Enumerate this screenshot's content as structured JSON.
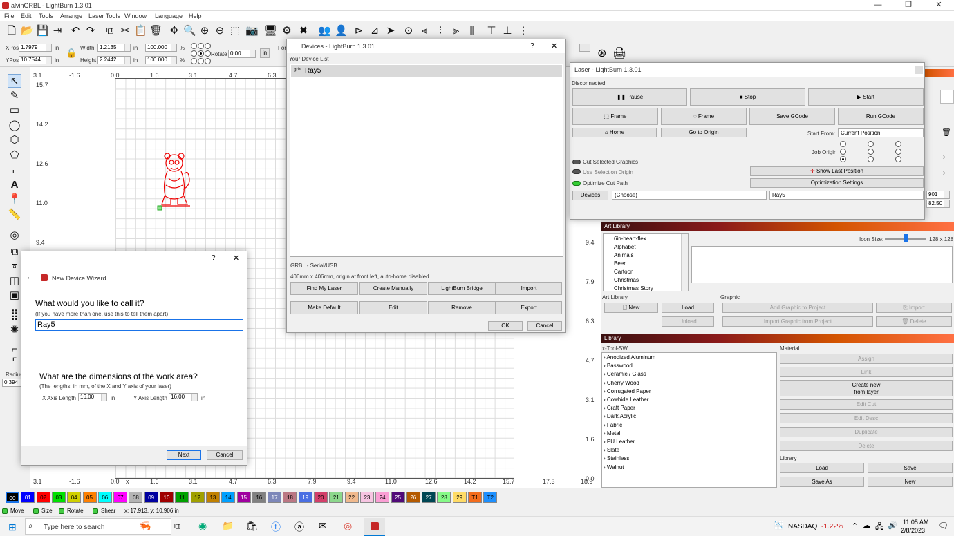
{
  "window": {
    "title": "alvinGRBL - LightBurn 1.3.01",
    "min": "—",
    "max": "❐",
    "close": "✕"
  },
  "menu": [
    "File",
    "Edit",
    "Tools",
    "Arrange",
    "Laser Tools",
    "Window",
    "Language",
    "Help"
  ],
  "numbar": {
    "xpos_label": "XPos",
    "xpos": "1.7979",
    "ypos_label": "YPos",
    "ypos": "10.7544",
    "unit": "in",
    "width_label": "Width",
    "width": "1.2135",
    "height_label": "Height",
    "height": "2.2442",
    "pct1": "100.000",
    "pct2": "100.000",
    "pct_sign": "%",
    "rotate_label": "Rotate",
    "rotate": "0.00",
    "rot_unit": "in",
    "font_label": "For"
  },
  "canvas": {
    "xticks": [
      "3.1",
      "-1.6",
      "0.0",
      "1.6",
      "3.1",
      "4.7",
      "6.3"
    ],
    "yticks": [
      "15.7",
      "14.2",
      "12.6",
      "11.0",
      "9.4"
    ],
    "bottom_ticks": [
      "3.1",
      "-1.6",
      "0.0",
      "x",
      "1.6",
      "3.1",
      "4.7",
      "6.3",
      "7.9",
      "9.4",
      "11.0",
      "12.6",
      "14.2",
      "15.7",
      "17.3",
      "18.9"
    ],
    "right_yticks": [
      "9.4",
      "7.9",
      "6.3",
      "4.7",
      "3.1",
      "1.6",
      "0.0"
    ],
    "radius_label": "Radius",
    "radius": "0.394"
  },
  "palette": [
    "00",
    "01",
    "02",
    "03",
    "04",
    "05",
    "06",
    "07",
    "08",
    "09",
    "10",
    "11",
    "12",
    "13",
    "14",
    "15",
    "16",
    "17",
    "18",
    "19",
    "20",
    "21",
    "22",
    "23",
    "24",
    "25",
    "26",
    "27",
    "28",
    "29",
    "T1",
    "T2"
  ],
  "palette_colors": [
    "#000000",
    "#0000ff",
    "#ff0000",
    "#00e000",
    "#d0d000",
    "#ff8000",
    "#00ffff",
    "#ff00ff",
    "#b4b4b4",
    "#0000a0",
    "#a00000",
    "#00a000",
    "#a0a000",
    "#c08000",
    "#00a0ff",
    "#a000a0",
    "#808080",
    "#7d87b9",
    "#bb7784",
    "#4a6fe3",
    "#d33f6a",
    "#8cd78c",
    "#f0b98d",
    "#f6c4e1",
    "#fa9ed4",
    "#500a78",
    "#b45a00",
    "#004754",
    "#86fa88",
    "#ffdb66",
    "#f36c1d",
    "#1e90ff"
  ],
  "status": {
    "move": "Move",
    "size": "Size",
    "rotate": "Rotate",
    "shear": "Shear",
    "coords": "x: 17.913, y: 10.906 in"
  },
  "devices": {
    "title": "Devices - LightBurn 1.3.01",
    "help": "?",
    "close": "✕",
    "list_label": "Your Device List",
    "device": "Ray5",
    "device_icon": "grbl",
    "type": "GRBL - Serial/USB",
    "desc": "406mm x 406mm, origin at front left, auto-home disabled",
    "btn_find": "Find My Laser",
    "btn_create": "Create Manually",
    "btn_bridge": "LightBurn Bridge",
    "btn_import": "Import",
    "btn_default": "Make Default",
    "btn_edit": "Edit",
    "btn_remove": "Remove",
    "btn_export": "Export",
    "btn_ok": "OK",
    "btn_cancel": "Cancel"
  },
  "wizard": {
    "help": "?",
    "close": "✕",
    "back": "←",
    "title": "New Device Wizard",
    "q1": "What would you like to call it?",
    "q1_hint": "(If you have more than one, use this to tell them apart)",
    "name": "Ray5",
    "q2": "What are the dimensions of the work area?",
    "q2_hint": "(The lengths, in mm, of the X and Y axis of your laser)",
    "x_label": "X Axis Length",
    "x_val": "16.00",
    "y_label": "Y Axis Length",
    "y_val": "16.00",
    "unit": "in",
    "next": "Next",
    "cancel": "Cancel"
  },
  "laser": {
    "title": "Laser - LightBurn 1.3.01",
    "status": "Disconnected",
    "pause": "Pause",
    "stop": "Stop",
    "start": "Start",
    "frame1": "Frame",
    "frame2": "Frame",
    "save_gcode": "Save GCode",
    "run_gcode": "Run GCode",
    "home": "Home",
    "go_origin": "Go to Origin",
    "start_from_label": "Start From:",
    "start_from": "Current Position",
    "job_origin": "Job Origin",
    "cut_selected": "Cut Selected Graphics",
    "use_selection": "Use Selection Origin",
    "optimize_cut": "Optimize Cut Path",
    "show_last": "Show Last Position",
    "opt_settings": "Optimization Settings",
    "devices_btn": "Devices",
    "choose": "(Choose)",
    "device_sel": "Ray5",
    "side_val1": "901",
    "side_val2": "82.50"
  },
  "artlib": {
    "title": "Art Library",
    "items": [
      "6in-heart-flex",
      "Alphabet",
      "Animals",
      "Beer",
      "Cartoon",
      "Christmas",
      "Christmas Story"
    ],
    "icon_size_label": "Icon Size:",
    "icon_size": "128 x 128",
    "art_library_label": "Art Library",
    "graphic_label": "Graphic",
    "new": "New",
    "load": "Load",
    "unload": "Unload",
    "add_graphic": "Add Graphic to Project",
    "import": "Import",
    "import_graphic": "Import Graphic from Project",
    "delete": "Delete"
  },
  "library": {
    "title": "Library",
    "lib_name": "x-Tool-SW",
    "material_label": "Material",
    "items": [
      "Anodized Aluminum",
      "Basswood",
      "Ceramic / Glass",
      "Cherry Wood",
      "Corrugated Paper",
      "Cowhide Leather",
      "Craft Paper",
      "Dark Acrylic",
      "Fabric",
      "Metal",
      "PU Leather",
      "Slate",
      "Stainless",
      "Walnut"
    ],
    "assign": "Assign",
    "link": "Link",
    "create_new": "Create new",
    "from_layer": "from layer",
    "edit_cut": "Edit Cut",
    "edit_desc": "Edit Desc",
    "duplicate": "Duplicate",
    "delete": "Delete",
    "library_label": "Library",
    "load": "Load",
    "save": "Save",
    "save_as": "Save As",
    "new": "New"
  },
  "taskbar": {
    "search": "Type here to search",
    "ticker": "NASDAQ",
    "change": "-1.22%",
    "time": "11:05 AM",
    "date": "2/8/2023"
  }
}
